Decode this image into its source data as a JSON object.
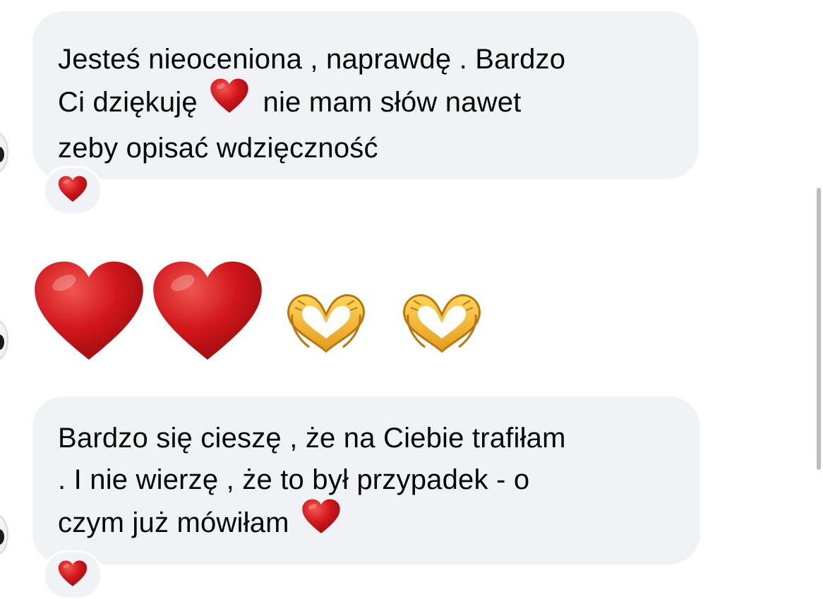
{
  "messages": [
    {
      "lines": [
        "Jesteś nieoceniona , naprawdę . Bardzo",
        "Ci dziękuję",
        "nie mam słów nawet",
        "zeby opisać wdzięczność"
      ],
      "reaction_icon": "red-heart-icon"
    },
    {
      "emojis": [
        "red-heart-icon",
        "red-heart-icon",
        "heart-hands-icon",
        "heart-hands-icon"
      ]
    },
    {
      "lines": [
        "Bardzo się cieszę , że na Ciebie trafiłam",
        ". I nie wierzę , że to był przypadek - o",
        "czym już mówiłam"
      ],
      "reaction_icon": "red-heart-icon"
    }
  ],
  "colors": {
    "bubble_bg": "#f0f2f5",
    "text": "#050505",
    "heart": "#d1161b",
    "hands": "#f2b52a"
  }
}
